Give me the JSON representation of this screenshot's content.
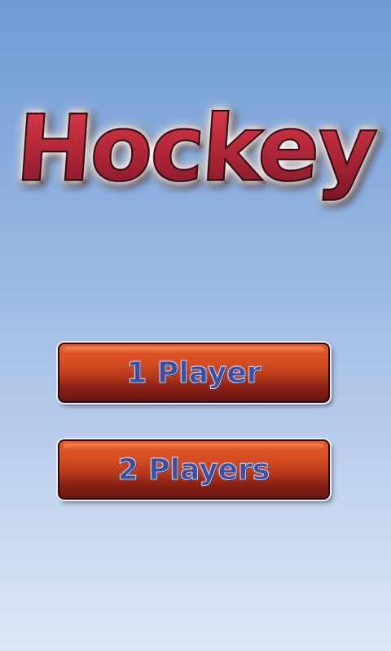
{
  "title": "Hockey",
  "buttons": {
    "one_player": "1 Player",
    "two_players": "2 Players"
  },
  "colors": {
    "sky_top": "#6f9bd6",
    "sky_bottom": "#dde7f5",
    "title_red": "#b82a3b",
    "button_orange": "#d84e22",
    "button_dark": "#6b1510",
    "label_blue": "#3a4fa0"
  }
}
